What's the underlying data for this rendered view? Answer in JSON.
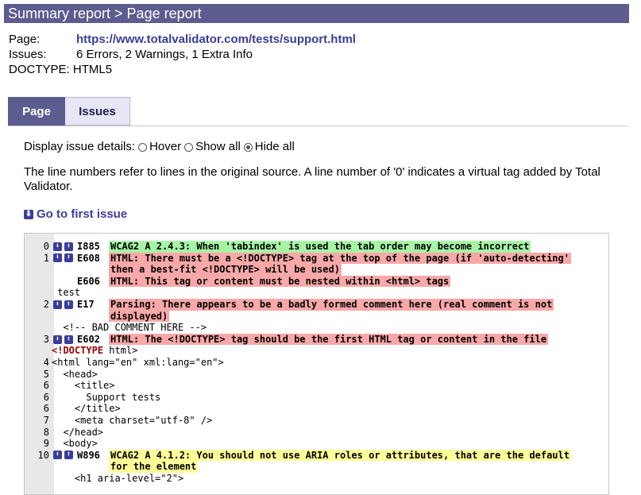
{
  "header": {
    "breadcrumb": "Summary report > Page report"
  },
  "meta": {
    "page_label": "Page:",
    "page_url": "https://www.totalvalidator.com/tests/support.html",
    "issues_label": "Issues:",
    "issues_value": "6 Errors, 2 Warnings, 1 Extra Info",
    "doctype_label": "DOCTYPE:",
    "doctype_value": "HTML5"
  },
  "tabs": [
    {
      "label": "Page",
      "active": true
    },
    {
      "label": "Issues",
      "active": false
    }
  ],
  "display": {
    "label": "Display issue details:",
    "options": [
      "Hover",
      "Show all",
      "Hide all"
    ],
    "selected": "Hide all"
  },
  "note": "The line numbers refer to lines in the original source. A line number of '0' indicates a virtual tag added by Total Validator.",
  "go_first": "Go to first issue",
  "code_lines": [
    {
      "n": "0",
      "icons": true,
      "id": "I885",
      "msg": "WCAG2 A 2.4.3: When 'tabindex' is used the tab order may become incorrect",
      "color": "green"
    },
    {
      "n": "1",
      "icons": true,
      "id": "E608",
      "msg": "HTML: There must be a <!DOCTYPE> tag at the top of the page (if 'auto-detecting'",
      "color": "red"
    },
    {
      "n": "",
      "cont": true,
      "msg": "then a best-fit <!DOCTYPE> will be used)",
      "color": "red"
    },
    {
      "n": "",
      "icons": false,
      "id": "E606",
      "msg": "HTML: This tag or content must be nested within <html> tags",
      "color": "red"
    },
    {
      "n": "",
      "src": " test"
    },
    {
      "n": "2",
      "icons": true,
      "id": "E17",
      "msg": "Parsing: There appears to be a badly formed comment here (real comment is not",
      "color": "red"
    },
    {
      "n": "",
      "cont": true,
      "msg": "displayed)",
      "color": "red"
    },
    {
      "n": "",
      "src": "  <!-- BAD COMMENT HERE -->"
    },
    {
      "n": "3",
      "icons": true,
      "id": "E602",
      "msg": "HTML: The <!DOCTYPE> tag should be the first HTML tag or content in the file",
      "color": "red"
    },
    {
      "n": "",
      "src_kw": "<!DOCTYPE",
      "src_rest": " html>"
    },
    {
      "n": "4",
      "src": "<html lang=\"en\" xml:lang=\"en\">"
    },
    {
      "n": "5",
      "src": "  <head>"
    },
    {
      "n": "6",
      "src": "    <title>"
    },
    {
      "n": "6",
      "src": "      Support tests"
    },
    {
      "n": "6",
      "src": "    </title>"
    },
    {
      "n": "7",
      "src": "    <meta charset=\"utf-8\" />"
    },
    {
      "n": "8",
      "src": "  </head>"
    },
    {
      "n": "9",
      "src": "  <body>"
    },
    {
      "n": "10",
      "icons": true,
      "id": "W896",
      "msg": "WCAG2 A 4.1.2: You should not use ARIA roles or attributes, that are the default",
      "color": "yellow"
    },
    {
      "n": "",
      "cont": true,
      "msg": "for the element",
      "color": "yellow"
    },
    {
      "n": "",
      "src": "    <h1 aria-level=\"2\">"
    }
  ]
}
